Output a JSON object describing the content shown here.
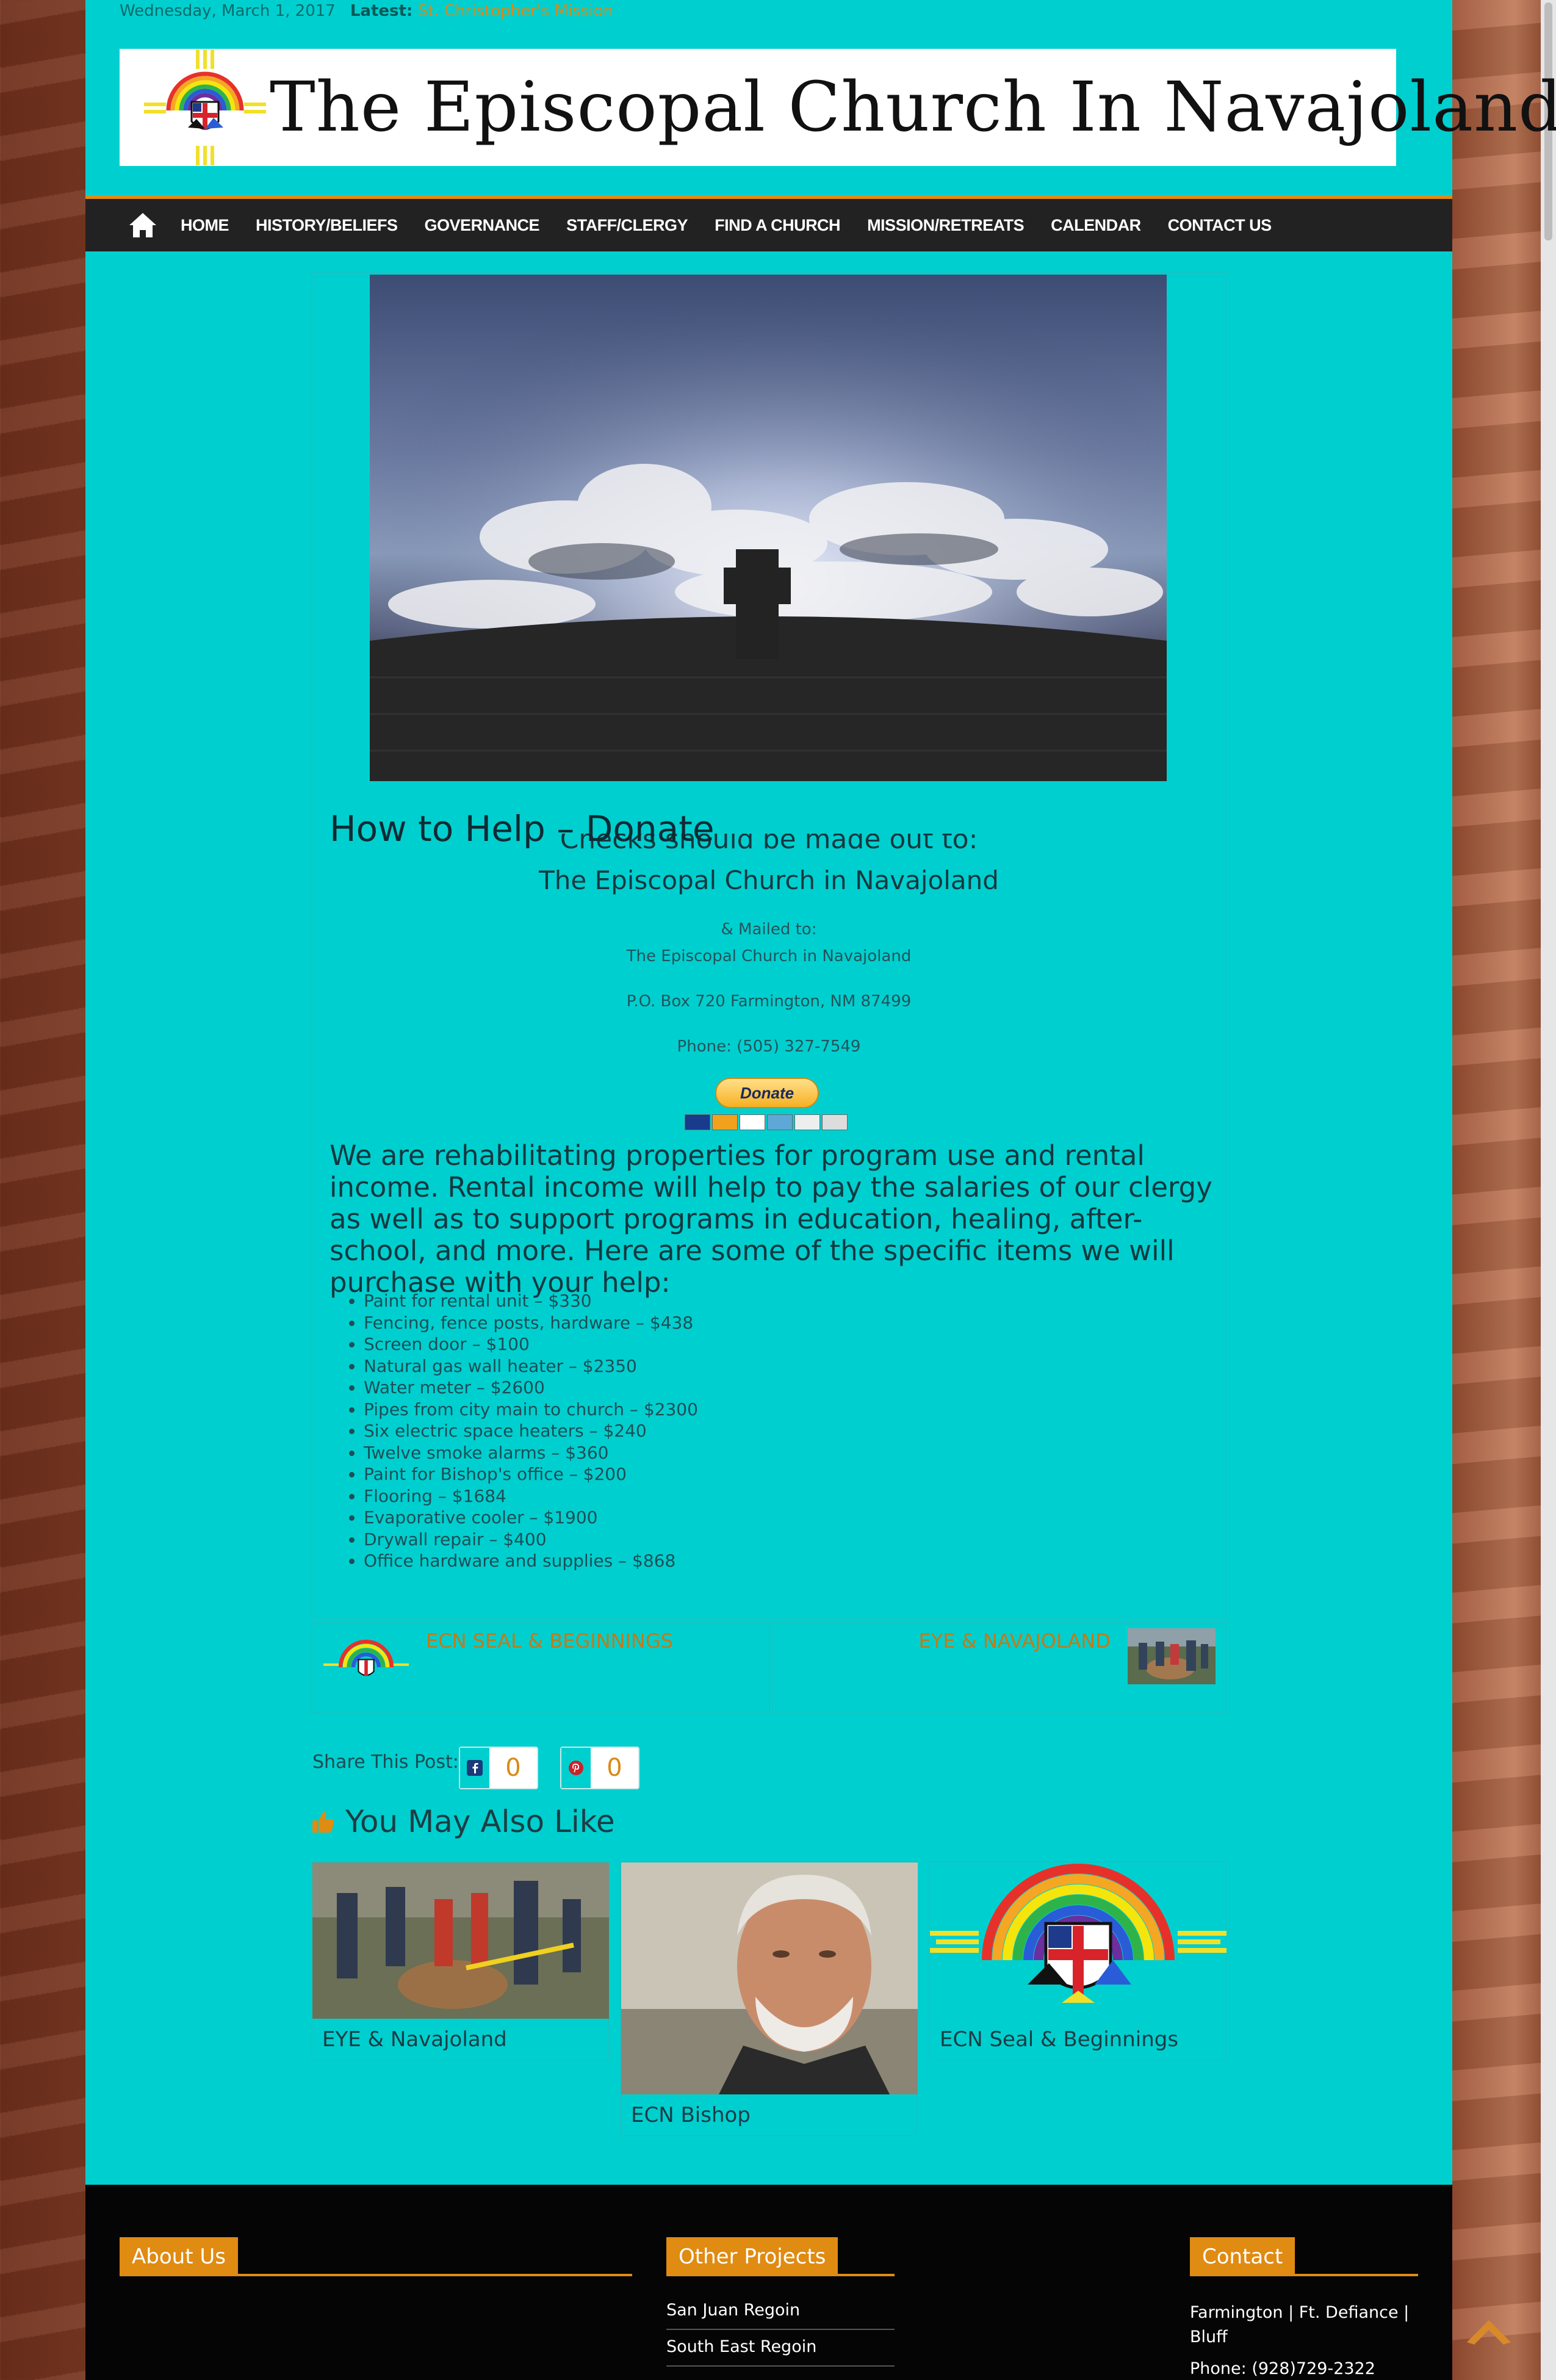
{
  "topbar": {
    "date": "Wednesday, March 1, 2017",
    "latest_label": "Latest:",
    "latest_link": "St. Christopher's Mission"
  },
  "header": {
    "site_title": "The Episcopal Church In Navajoland"
  },
  "nav": {
    "items": [
      "HOME",
      "HISTORY/BELIEFS",
      "GOVERNANCE",
      "STAFF/CLERGY",
      "FIND A CHURCH",
      "MISSION/RETREATS",
      "CALENDAR",
      "CONTACT US"
    ]
  },
  "post": {
    "title": "How to Help – Donate",
    "checks_line_1": "Checks should be made out to:",
    "checks_line_2": "The Episcopal Church in Navajoland",
    "mailed_to": "& Mailed to:",
    "mail_name": "The Episcopal Church in Navajoland",
    "po_box": "P.O. Box 720 Farmington, NM 87499",
    "phone": "Phone: (505) 327-7549",
    "donate_label": "Donate",
    "intro": "We are rehabilitating properties for program use and rental income. Rental income will help to pay the salaries of our clergy as well as to support programs in education, healing, after-school, and more. Here are some of the specific items we will purchase with your help:",
    "items": [
      "Paint for rental unit – $330",
      "Fencing, fence posts, hardware – $438",
      "Screen door – $100",
      "Natural gas wall heater – $2350",
      "Water meter – $2600",
      "Pipes from city main to church – $2300",
      "Six electric space heaters – $240",
      "Twelve smoke alarms – $360",
      "Paint for Bishop's office – $200",
      "Flooring – $1684",
      "Evaporative cooler – $1900",
      "Drywall repair – $400",
      "Office hardware and supplies – $868"
    ]
  },
  "prev_next": {
    "prev": "ECN SEAL & BEGINNINGS",
    "next": "EYE & NAVAJOLAND"
  },
  "share": {
    "label": "Share This Post:",
    "facebook_count": "0",
    "pinterest_count": "0"
  },
  "related": {
    "heading": "You May Also Like",
    "items": [
      "EYE & Navajoland",
      "ECN Bishop",
      "ECN Seal & Beginnings"
    ]
  },
  "footer": {
    "about_heading": "About Us",
    "projects_heading": "Other Projects",
    "projects": [
      "San Juan Regoin",
      "South East Regoin"
    ],
    "contact_heading": "Contact",
    "contact_locations": "Farmington | Ft. Defiance | Bluff",
    "contact_phone": "Phone: (928)729-2322"
  },
  "colors": {
    "page_bg": "#00cfcf",
    "accent": "#e08b12",
    "navbar": "#222222",
    "footer": "#050505"
  },
  "icons": [
    "home-icon",
    "facebook-icon",
    "pinterest-icon",
    "thumbs-up-icon",
    "back-to-top-icon"
  ]
}
